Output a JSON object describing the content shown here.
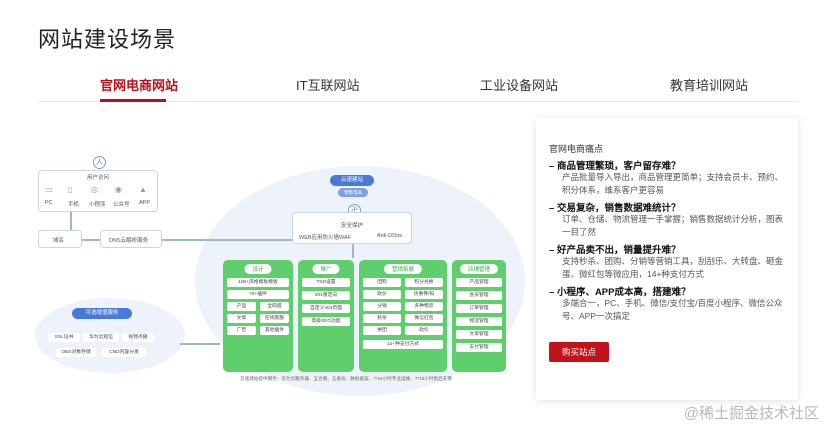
{
  "page": {
    "title": "网站建设场景"
  },
  "tabs": [
    {
      "label": "官网电商网站",
      "active": true
    },
    {
      "label": "IT互联网站",
      "active": false
    },
    {
      "label": "工业设备网站",
      "active": false
    },
    {
      "label": "教育培训网站",
      "active": false
    }
  ],
  "diagram": {
    "user": {
      "title": "用户访问",
      "devices": [
        "PC",
        "手机",
        "小程序",
        "公众号",
        "APP"
      ]
    },
    "domain": "域名",
    "dns": "DNS云解析服务",
    "cloud_top": "云速建站",
    "cloud_sub": "零售电商",
    "security": {
      "title": "安全保护",
      "waf": "WEB应用防火墙WAF",
      "ddos": "Anti-DDos"
    },
    "service": {
      "title": "可选增值服务",
      "items": [
        "SSL证书",
        "华为云短信",
        "视频点播",
        "OBS对象存储",
        "CND内容分发"
      ]
    },
    "cards": [
      {
        "head": "设计",
        "items": [
          "100+风格模板模板",
          "70+插件",
          "产品",
          "全码搭",
          "文章",
          "在线客服",
          "广告",
          "其他插件"
        ]
      },
      {
        "head": "推广",
        "items": [
          "TKD设置",
          "301重定向",
          "自定义404页面",
          "高级SEO功能"
        ]
      },
      {
        "head": "营销拓展",
        "items": [
          "团购",
          "积分兑换",
          "砍价",
          "优惠券/码",
          "分销",
          "多种物流",
          "秒杀",
          "微信红包",
          "拼团",
          "砍价",
          "14+种支付方式"
        ]
      },
      {
        "head": "店铺管理",
        "items": [
          "产品管理",
          "会员管理",
          "订单管理",
          "物流管理",
          "文章管理",
          "支付管理"
        ]
      }
    ],
    "footer_note": "云速建站提供服务：华为云服务器、五合版、五备份、数据备案、7*24小时专业运维、7*15小时售后支撑"
  },
  "panel": {
    "title": "官网电商痛点",
    "points": [
      {
        "title": "商品管理繁琐，客户留存难？",
        "desc": "产品批量导入导出，商品管理更简单；支持会员卡、预约、积分体系，维系客户更容易"
      },
      {
        "title": "交易复杂，销售数据难统计？",
        "desc": "订单、仓储、物流管理一手掌握；销售数据统计分析，图表一目了然"
      },
      {
        "title": "好产品卖不出，销量提升难？",
        "desc": "支持秒杀、团购、分销等营销工具，刮刮乐、大转盘、砸金蛋、微红包等微应用，14+种支付方式"
      },
      {
        "title": "小程序、APP成本高，搭建难？",
        "desc": "多端合一，PC、手机、微信/支付宝/百度小程序、微信公众号、APP一次搞定"
      }
    ],
    "button": "购买站点"
  },
  "watermark": "@稀土掘金技术社区",
  "colors": {
    "accent": "#b5121b",
    "button": "#c0141d",
    "card_green": "#5fcf6e",
    "pill_blue": "#4b79d8"
  }
}
